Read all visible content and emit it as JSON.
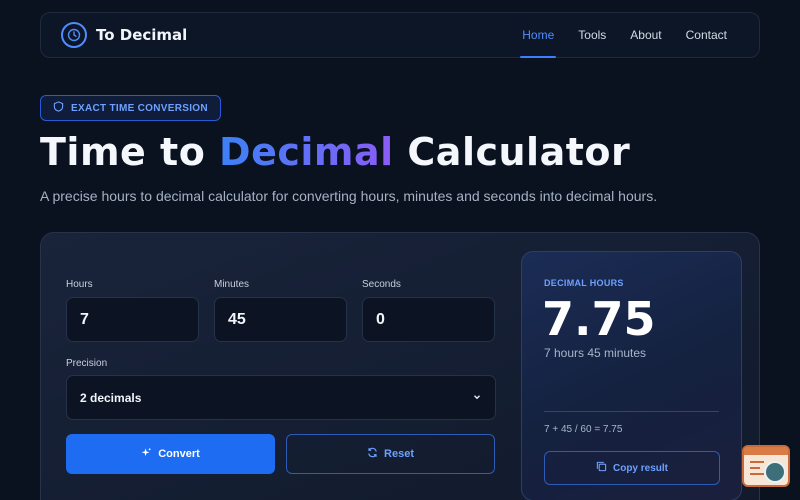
{
  "brand": {
    "name": "To Decimal",
    "icon": "clock-icon"
  },
  "nav": {
    "items": [
      {
        "label": "Home",
        "active": true
      },
      {
        "label": "Tools",
        "active": false
      },
      {
        "label": "About",
        "active": false
      },
      {
        "label": "Contact",
        "active": false
      }
    ]
  },
  "badge": {
    "text": "EXACT TIME CONVERSION",
    "icon": "shield-icon"
  },
  "hero": {
    "title_part1": "Time to ",
    "title_accent": "Decimal",
    "title_part2": " Calculator",
    "subtitle": "A precise hours to decimal calculator for converting hours, minutes and seconds into decimal hours."
  },
  "form": {
    "hours": {
      "label": "Hours",
      "value": "7"
    },
    "minutes": {
      "label": "Minutes",
      "value": "45"
    },
    "seconds": {
      "label": "Seconds",
      "value": "0"
    },
    "precision": {
      "label": "Precision",
      "selected": "2 decimals"
    },
    "convert_label": "Convert",
    "reset_label": "Reset"
  },
  "result": {
    "label": "DECIMAL HOURS",
    "value": "7.75",
    "words": "7 hours 45 minutes",
    "formula": "7 + 45 / 60 = 7.75",
    "copy_label": "Copy result"
  },
  "colors": {
    "accent": "#1d6cf2",
    "background": "#0a1220",
    "link": "#4d8dff"
  }
}
